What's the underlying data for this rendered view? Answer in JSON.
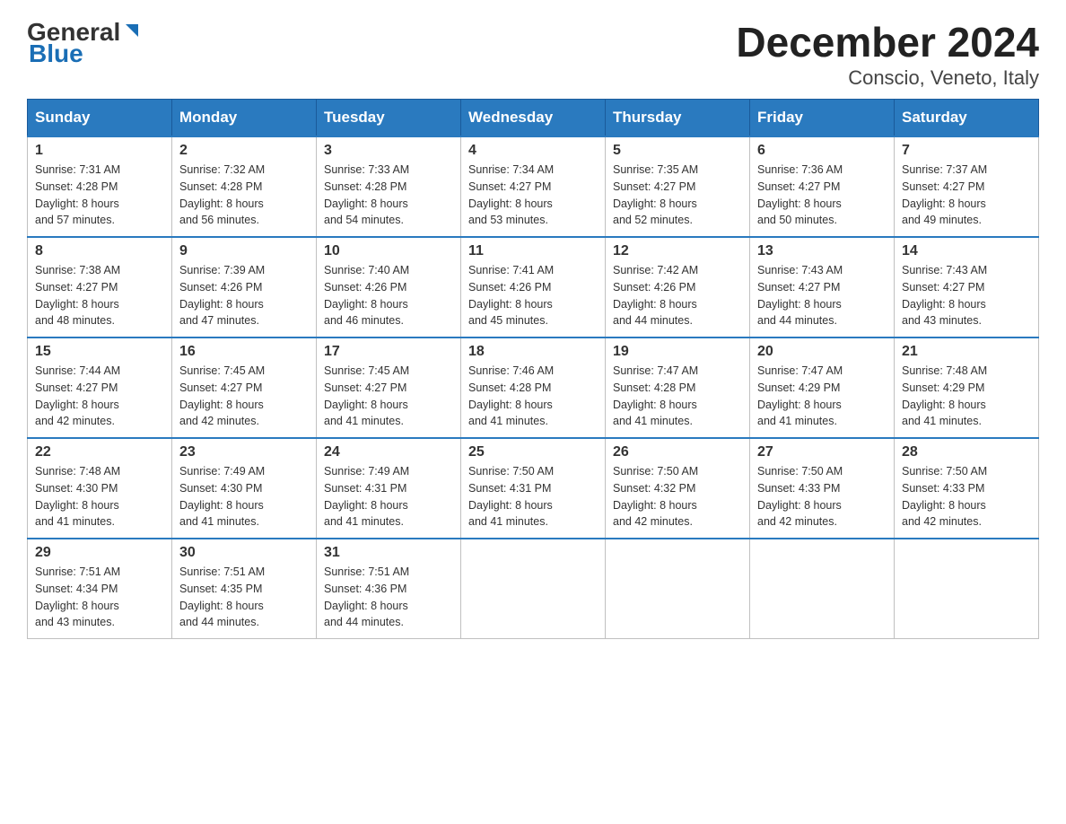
{
  "header": {
    "logo_general": "General",
    "logo_blue": "Blue",
    "title": "December 2024",
    "subtitle": "Conscio, Veneto, Italy"
  },
  "days_of_week": [
    "Sunday",
    "Monday",
    "Tuesday",
    "Wednesday",
    "Thursday",
    "Friday",
    "Saturday"
  ],
  "weeks": [
    [
      {
        "day": "1",
        "sunrise": "7:31 AM",
        "sunset": "4:28 PM",
        "daylight": "8 hours and 57 minutes."
      },
      {
        "day": "2",
        "sunrise": "7:32 AM",
        "sunset": "4:28 PM",
        "daylight": "8 hours and 56 minutes."
      },
      {
        "day": "3",
        "sunrise": "7:33 AM",
        "sunset": "4:28 PM",
        "daylight": "8 hours and 54 minutes."
      },
      {
        "day": "4",
        "sunrise": "7:34 AM",
        "sunset": "4:27 PM",
        "daylight": "8 hours and 53 minutes."
      },
      {
        "day": "5",
        "sunrise": "7:35 AM",
        "sunset": "4:27 PM",
        "daylight": "8 hours and 52 minutes."
      },
      {
        "day": "6",
        "sunrise": "7:36 AM",
        "sunset": "4:27 PM",
        "daylight": "8 hours and 50 minutes."
      },
      {
        "day": "7",
        "sunrise": "7:37 AM",
        "sunset": "4:27 PM",
        "daylight": "8 hours and 49 minutes."
      }
    ],
    [
      {
        "day": "8",
        "sunrise": "7:38 AM",
        "sunset": "4:27 PM",
        "daylight": "8 hours and 48 minutes."
      },
      {
        "day": "9",
        "sunrise": "7:39 AM",
        "sunset": "4:26 PM",
        "daylight": "8 hours and 47 minutes."
      },
      {
        "day": "10",
        "sunrise": "7:40 AM",
        "sunset": "4:26 PM",
        "daylight": "8 hours and 46 minutes."
      },
      {
        "day": "11",
        "sunrise": "7:41 AM",
        "sunset": "4:26 PM",
        "daylight": "8 hours and 45 minutes."
      },
      {
        "day": "12",
        "sunrise": "7:42 AM",
        "sunset": "4:26 PM",
        "daylight": "8 hours and 44 minutes."
      },
      {
        "day": "13",
        "sunrise": "7:43 AM",
        "sunset": "4:27 PM",
        "daylight": "8 hours and 44 minutes."
      },
      {
        "day": "14",
        "sunrise": "7:43 AM",
        "sunset": "4:27 PM",
        "daylight": "8 hours and 43 minutes."
      }
    ],
    [
      {
        "day": "15",
        "sunrise": "7:44 AM",
        "sunset": "4:27 PM",
        "daylight": "8 hours and 42 minutes."
      },
      {
        "day": "16",
        "sunrise": "7:45 AM",
        "sunset": "4:27 PM",
        "daylight": "8 hours and 42 minutes."
      },
      {
        "day": "17",
        "sunrise": "7:45 AM",
        "sunset": "4:27 PM",
        "daylight": "8 hours and 41 minutes."
      },
      {
        "day": "18",
        "sunrise": "7:46 AM",
        "sunset": "4:28 PM",
        "daylight": "8 hours and 41 minutes."
      },
      {
        "day": "19",
        "sunrise": "7:47 AM",
        "sunset": "4:28 PM",
        "daylight": "8 hours and 41 minutes."
      },
      {
        "day": "20",
        "sunrise": "7:47 AM",
        "sunset": "4:29 PM",
        "daylight": "8 hours and 41 minutes."
      },
      {
        "day": "21",
        "sunrise": "7:48 AM",
        "sunset": "4:29 PM",
        "daylight": "8 hours and 41 minutes."
      }
    ],
    [
      {
        "day": "22",
        "sunrise": "7:48 AM",
        "sunset": "4:30 PM",
        "daylight": "8 hours and 41 minutes."
      },
      {
        "day": "23",
        "sunrise": "7:49 AM",
        "sunset": "4:30 PM",
        "daylight": "8 hours and 41 minutes."
      },
      {
        "day": "24",
        "sunrise": "7:49 AM",
        "sunset": "4:31 PM",
        "daylight": "8 hours and 41 minutes."
      },
      {
        "day": "25",
        "sunrise": "7:50 AM",
        "sunset": "4:31 PM",
        "daylight": "8 hours and 41 minutes."
      },
      {
        "day": "26",
        "sunrise": "7:50 AM",
        "sunset": "4:32 PM",
        "daylight": "8 hours and 42 minutes."
      },
      {
        "day": "27",
        "sunrise": "7:50 AM",
        "sunset": "4:33 PM",
        "daylight": "8 hours and 42 minutes."
      },
      {
        "day": "28",
        "sunrise": "7:50 AM",
        "sunset": "4:33 PM",
        "daylight": "8 hours and 42 minutes."
      }
    ],
    [
      {
        "day": "29",
        "sunrise": "7:51 AM",
        "sunset": "4:34 PM",
        "daylight": "8 hours and 43 minutes."
      },
      {
        "day": "30",
        "sunrise": "7:51 AM",
        "sunset": "4:35 PM",
        "daylight": "8 hours and 44 minutes."
      },
      {
        "day": "31",
        "sunrise": "7:51 AM",
        "sunset": "4:36 PM",
        "daylight": "8 hours and 44 minutes."
      },
      null,
      null,
      null,
      null
    ]
  ],
  "labels": {
    "sunrise": "Sunrise:",
    "sunset": "Sunset:",
    "daylight": "Daylight:"
  }
}
